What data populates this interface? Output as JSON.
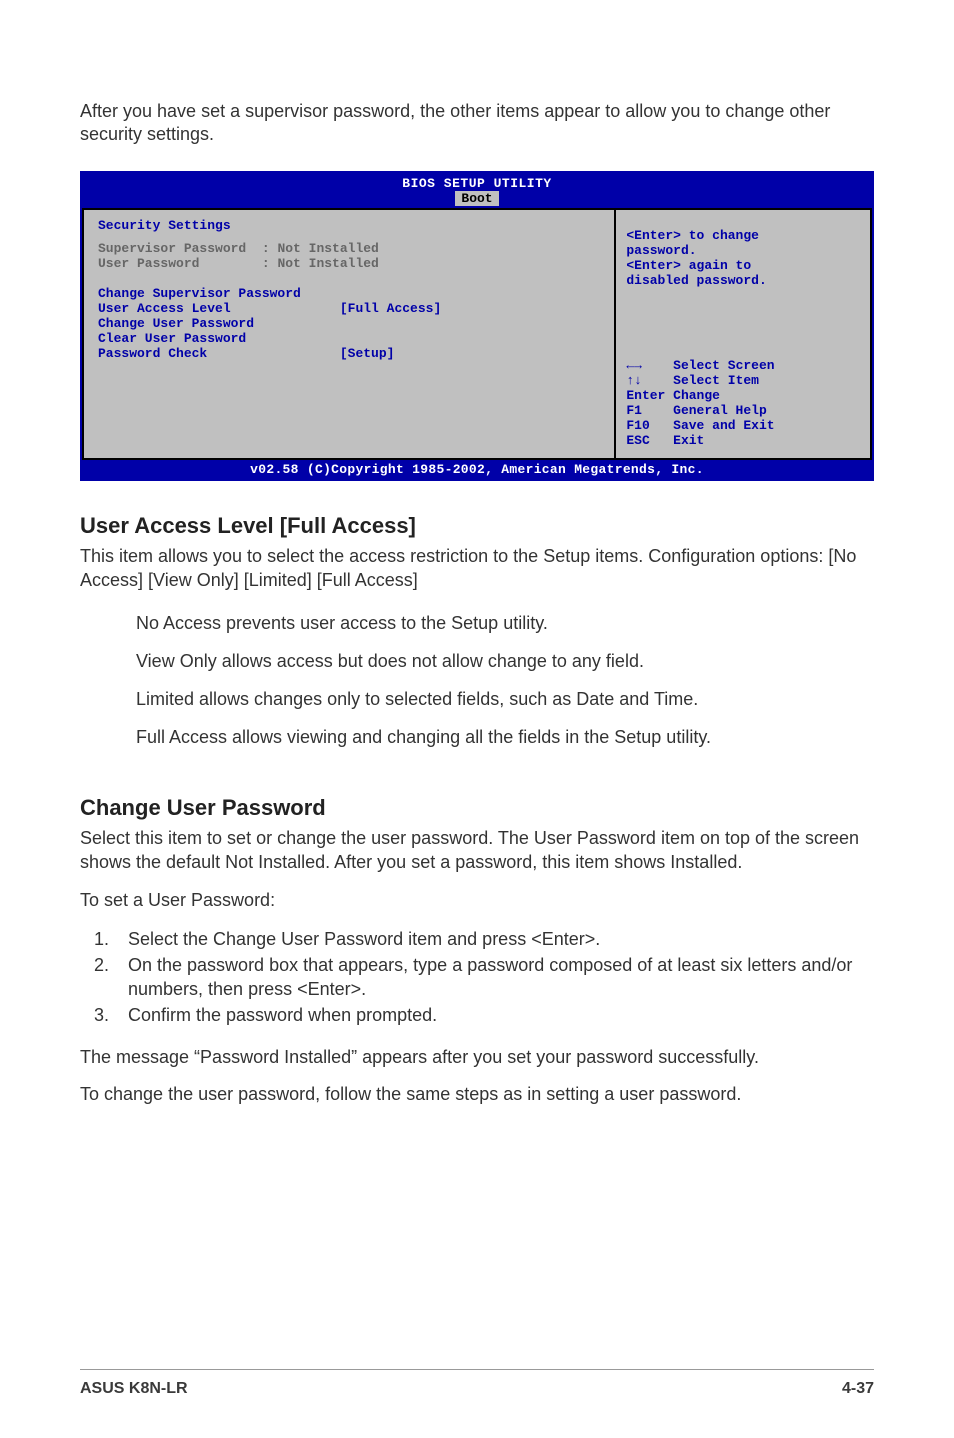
{
  "intro": "After you have set a supervisor password, the other items appear to allow you to change other security settings.",
  "bios": {
    "title": "BIOS SETUP UTILITY",
    "tab": "Boot",
    "section_title": "Security Settings",
    "sup_pass_label": "Supervisor Password",
    "sup_pass_val": ": Not Installed",
    "user_pass_label": "User Password",
    "user_pass_val": ": Not Installed",
    "change_sup": "Change Supervisor Password",
    "ual_label": "User Access Level",
    "ual_val": "[Full Access]",
    "change_user": "Change User Password",
    "clear_user": "Clear User Password",
    "pw_check_label": "Password Check",
    "pw_check_val": "[Setup]",
    "help1": "<Enter> to change",
    "help2": "password.",
    "help3": "<Enter> again to",
    "help4": "disabled password.",
    "nav": {
      "select_screen": "Select Screen",
      "select_item": "Select Item",
      "enter": "Enter Change",
      "f1": "F1    General Help",
      "f10": "F10   Save and Exit",
      "esc": "ESC   Exit"
    },
    "copyright": "v02.58 (C)Copyright 1985-2002, American Megatrends, Inc."
  },
  "s1": {
    "heading": "User Access Level [Full Access]",
    "p1": "This item allows you to select the access restriction to the Setup items. Configuration options: [No Access] [View Only] [Limited] [Full Access]",
    "b1": "No Access prevents user access to the Setup utility.",
    "b2": "View Only allows access but does not allow change to any field.",
    "b3": "Limited allows changes only to selected fields, such as Date and Time.",
    "b4": "Full Access allows viewing and changing all the fields in the Setup utility."
  },
  "s2": {
    "heading": "Change User Password",
    "p1": "Select this item to set or change the user password. The User Password item on top of the screen shows the default Not Installed. After you set a password, this item shows Installed.",
    "p2": "To set a User Password:",
    "steps": [
      "Select the Change User Password item and press <Enter>.",
      "On the password box that appears, type a password composed of at least six letters and/or numbers, then press <Enter>.",
      "Confirm the password when prompted."
    ],
    "p3": "The message “Password Installed” appears after you set your password successfully.",
    "p4": "To change the user password, follow the same steps as in setting a user password."
  },
  "footer": {
    "left": "ASUS K8N-LR",
    "right": "4-37"
  }
}
